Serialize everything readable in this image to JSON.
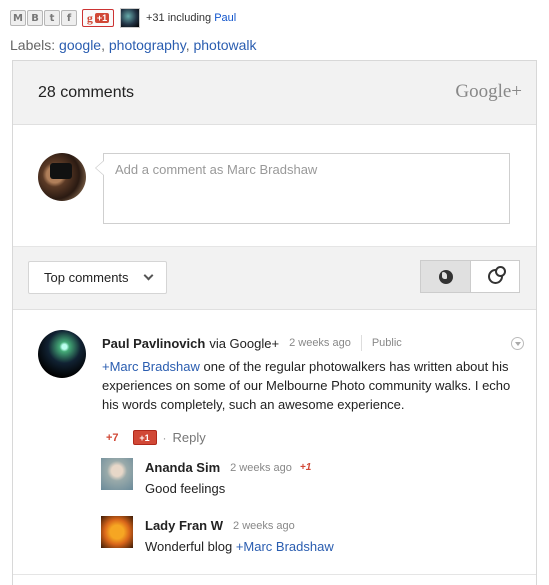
{
  "share_bar": {
    "buttons": [
      "M",
      "B",
      "t",
      "f"
    ],
    "button_icons": [
      "email-icon",
      "blogger-icon",
      "twitter-icon",
      "facebook-icon"
    ],
    "plus_one_g": "g",
    "plus_one_label": "+1",
    "plus_count_text": "+31 including ",
    "plus_count_name": "Paul"
  },
  "labels": {
    "prefix": "Labels:",
    "items": [
      "google",
      "photography",
      "photowalk"
    ],
    "separator": ", "
  },
  "header": {
    "comment_count": "28 comments",
    "brand": "Google+"
  },
  "compose": {
    "placeholder": "Add a comment as Marc Bradshaw"
  },
  "toolbar": {
    "sort_label": "Top comments"
  },
  "comment": {
    "author": "Paul Pavlinovich",
    "via": "via Google+",
    "time": "2 weeks ago",
    "visibility": "Public",
    "mention": "+Marc Bradshaw",
    "text": " one of the regular photowalkers has written about his experiences on some of our Melbourne Photo community walks. I echo his words completely, such an awesome experience.",
    "plus_count": "+7",
    "plus_button": "+1",
    "dot": "·",
    "reply_label": "Reply"
  },
  "replies": [
    {
      "author": "Ananda Sim",
      "time": "2 weeks ago",
      "plus": "+1",
      "text": "Good feelings",
      "mention": ""
    },
    {
      "author": "Lady Fran W",
      "time": "2 weeks ago",
      "plus": "",
      "text": "Wonderful blog ",
      "mention": "+Marc Bradshaw"
    }
  ],
  "colors": {
    "link": "#2a5db0",
    "google_red": "#d14836",
    "panel_gray": "#f2f2f2"
  }
}
